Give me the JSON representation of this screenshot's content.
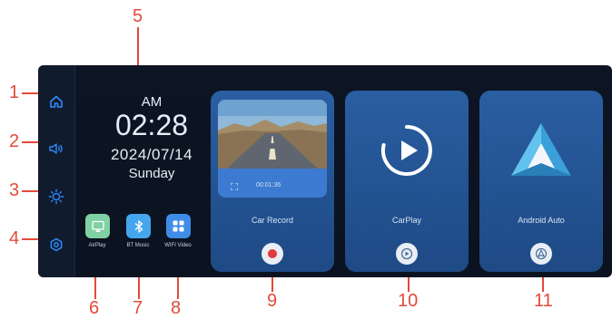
{
  "callouts": [
    "1",
    "2",
    "3",
    "4",
    "5",
    "6",
    "7",
    "8",
    "9",
    "10",
    "11"
  ],
  "clock": {
    "ampm": "AM",
    "time": "02:28",
    "date": "2024/07/14",
    "weekday": "Sunday"
  },
  "sidebar": {
    "items": [
      {
        "icon": "home-icon"
      },
      {
        "icon": "volume-icon"
      },
      {
        "icon": "brightness-icon"
      },
      {
        "icon": "settings-icon"
      }
    ],
    "accent": "#2f8cff"
  },
  "apps": [
    {
      "label": "AirPlay",
      "icon": "airplay-icon",
      "color": "#7fd1a3"
    },
    {
      "label": "BT Music",
      "icon": "bluetooth-icon",
      "color": "#45a6ee"
    },
    {
      "label": "WIFI Video",
      "icon": "grid-icon",
      "color": "#3f8ce8"
    }
  ],
  "cards": [
    {
      "title": "Car Record",
      "timestamp": "00:01:36",
      "button_icon": "record-icon"
    },
    {
      "title": "CarPlay",
      "button_icon": "carplay-icon"
    },
    {
      "title": "Android Auto",
      "button_icon": "android-auto-icon"
    }
  ],
  "colors": {
    "callout": "#e24a3b",
    "card": "#2a5ea2",
    "record": "#e23a3a"
  }
}
